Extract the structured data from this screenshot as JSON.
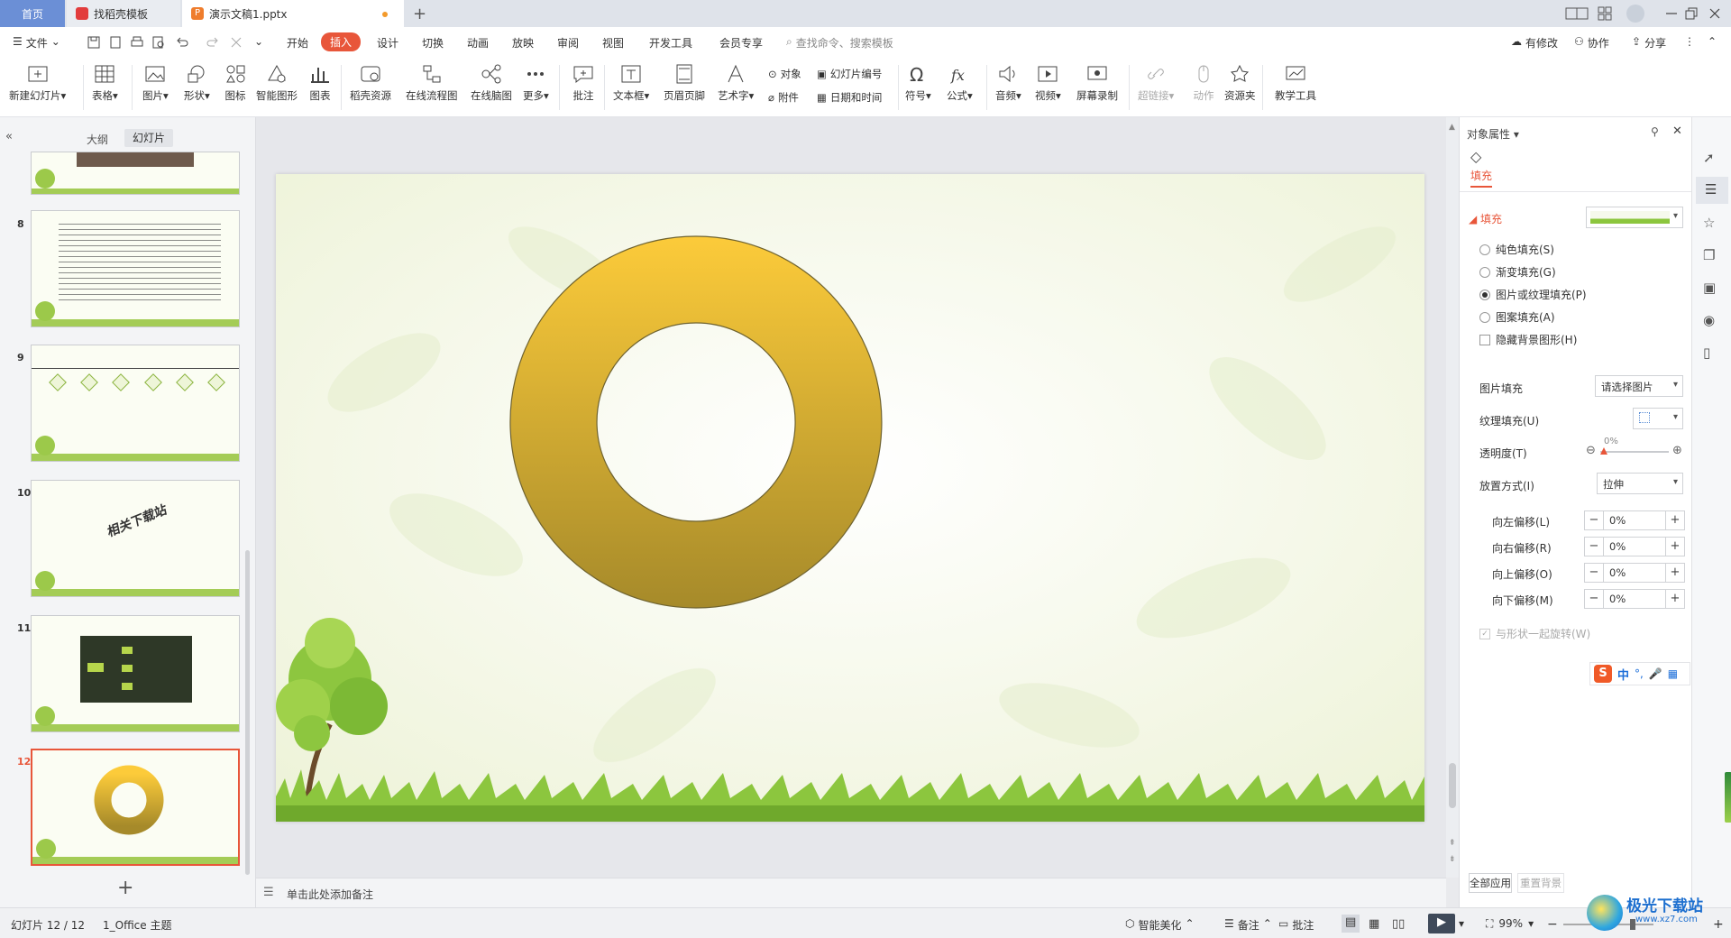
{
  "tabs": {
    "home": "首页",
    "docer": "找稻壳模板",
    "doc": "演示文稿1.pptx",
    "new_tab": "+"
  },
  "menu": {
    "file": "文件",
    "items": [
      "开始",
      "插入",
      "设计",
      "切换",
      "动画",
      "放映",
      "审阅",
      "视图",
      "开发工具",
      "会员专享"
    ],
    "search_placeholder": "查找命令、搜索模板",
    "modified": "有修改",
    "collab": "协作",
    "share": "分享"
  },
  "ribbon": {
    "new_slide": "新建幻灯片",
    "table": "表格",
    "picture": "图片",
    "shape": "形状",
    "icon": "图标",
    "smart_art": "智能图形",
    "chart": "图表",
    "docer_res": "稻壳资源",
    "flowchart": "在线流程图",
    "mindmap": "在线脑图",
    "more": "更多",
    "comment": "批注",
    "textbox": "文本框",
    "header_footer": "页眉页脚",
    "wordart": "艺术字",
    "object": "对象",
    "slide_number": "幻灯片编号",
    "attachment": "附件",
    "datetime": "日期和时间",
    "symbol": "符号",
    "formula": "公式",
    "audio": "音频",
    "video": "视频",
    "screen_record": "屏幕录制",
    "hyperlink": "超链接",
    "action": "动作",
    "resource": "资源夹",
    "teach_tools": "教学工具"
  },
  "left_panel": {
    "tab_outline": "大纲",
    "tab_slides": "幻灯片",
    "slides": [
      {
        "num": "8"
      },
      {
        "num": "9"
      },
      {
        "num": "10",
        "text": "相关下载站"
      },
      {
        "num": "11"
      },
      {
        "num": "12"
      }
    ],
    "add_slide": "+"
  },
  "notes_placeholder": "单击此处添加备注",
  "right_panel": {
    "title": "对象属性",
    "tab_fill": "填充",
    "section_fill": "填充",
    "opt_solid": "纯色填充(S)",
    "opt_gradient": "渐变填充(G)",
    "opt_picture": "图片或纹理填充(P)",
    "opt_pattern": "图案填充(A)",
    "opt_hide_bg": "隐藏背景图形(H)",
    "pic_fill_label": "图片填充",
    "pic_fill_value": "请选择图片",
    "texture_label": "纹理填充(U)",
    "transparency_label": "透明度(T)",
    "transparency_value": "0%",
    "placement_label": "放置方式(I)",
    "placement_value": "拉伸",
    "off_left_label": "向左偏移(L)",
    "off_right_label": "向右偏移(R)",
    "off_top_label": "向上偏移(O)",
    "off_bottom_label": "向下偏移(M)",
    "off_left": "0%",
    "off_right": "0%",
    "off_top": "0%",
    "off_bottom": "0%",
    "rotate_with_shape": "与形状一起旋转(W)",
    "apply_all": "全部应用",
    "reset_bg": "重置背景"
  },
  "ime": {
    "lang": "中"
  },
  "status": {
    "slide_counter": "幻灯片 12 / 12",
    "theme": "1_Office 主题",
    "smart_beautify": "智能美化",
    "notes": "备注",
    "comments": "批注",
    "zoom": "99%",
    "watermark": "极光下载站",
    "watermark_url": "www.xz7.com"
  },
  "colors": {
    "accent": "#e8563a",
    "ring_top": "#fccb3a",
    "ring_bottom": "#a68a2a",
    "grass": "#8cc63e"
  }
}
